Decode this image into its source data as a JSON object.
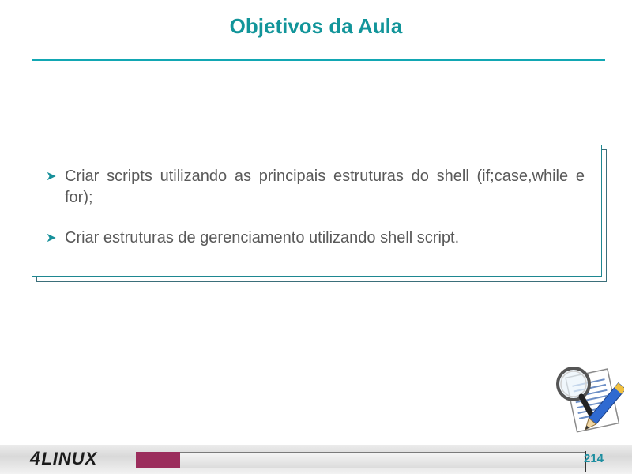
{
  "slide": {
    "title": "Objetivos da Aula",
    "bullets": [
      "Criar scripts utilizando as principais estruturas do shell (if;case,while e for);",
      "Criar estruturas de gerenciamento utilizando shell script."
    ]
  },
  "footer": {
    "logo_text": "LINUX",
    "logo_digit": "4",
    "page_number": "214"
  },
  "colors": {
    "title": "#12959a",
    "accent": "#9b2d5c",
    "bullet_arrow": "#17909a"
  },
  "icons": {
    "bullet": "arrow-bullet-icon",
    "clipart": "magnifier-document-pencil-icon"
  }
}
